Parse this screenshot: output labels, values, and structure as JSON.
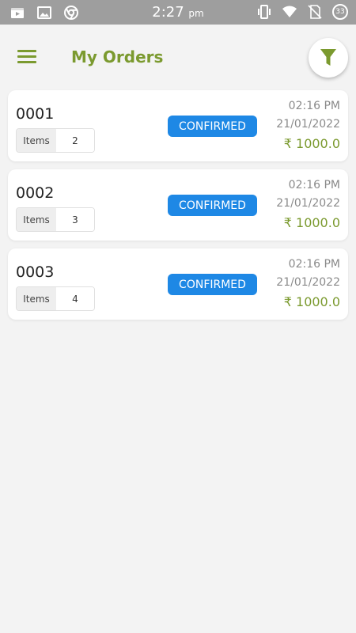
{
  "status_bar": {
    "time": "2:27",
    "ampm": "pm",
    "battery": "33"
  },
  "header": {
    "title": "My Orders"
  },
  "orders": [
    {
      "id": "0001",
      "items_label": "Items",
      "items_count": "2",
      "status": "CONFIRMED",
      "time": "02:16 PM",
      "date": "21/01/2022",
      "amount": "₹ 1000.0"
    },
    {
      "id": "0002",
      "items_label": "Items",
      "items_count": "3",
      "status": "CONFIRMED",
      "time": "02:16 PM",
      "date": "21/01/2022",
      "amount": "₹ 1000.0"
    },
    {
      "id": "0003",
      "items_label": "Items",
      "items_count": "4",
      "status": "CONFIRMED",
      "time": "02:16 PM",
      "date": "21/01/2022",
      "amount": "₹ 1000.0"
    }
  ],
  "colors": {
    "accent": "#7b9a2f",
    "status_badge": "#1e88e5",
    "status_bar": "#9e9e9e",
    "background": "#f3f3f3"
  },
  "icons": {
    "menu": "hamburger-icon",
    "filter": "filter-icon",
    "status_bar": [
      "video-icon",
      "gallery-icon",
      "chrome-icon",
      "vibrate-icon",
      "wifi-icon",
      "no-sim-icon",
      "battery-icon"
    ]
  }
}
